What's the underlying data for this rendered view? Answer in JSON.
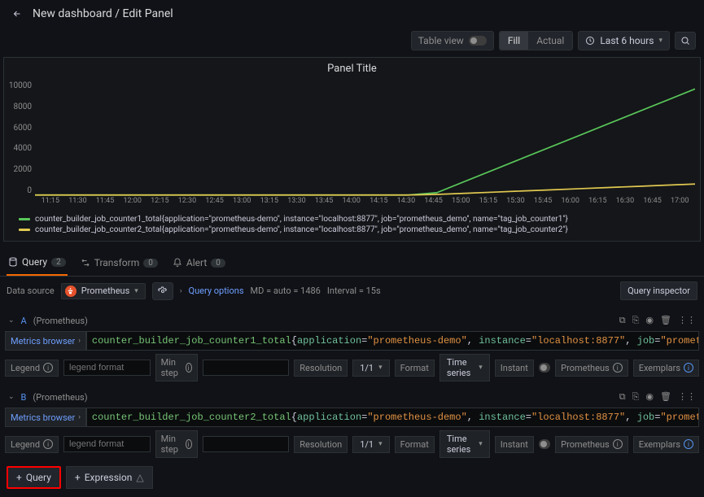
{
  "breadcrumb": "New dashboard / Edit Panel",
  "toolbar": {
    "table_view": "Table view",
    "fill": "Fill",
    "actual": "Actual",
    "time_range": "Last 6 hours"
  },
  "panel": {
    "title": "Panel Title"
  },
  "chart_data": {
    "type": "line",
    "x": [
      "11:15",
      "11:30",
      "11:45",
      "12:00",
      "12:15",
      "12:30",
      "12:45",
      "13:00",
      "13:15",
      "13:30",
      "13:45",
      "14:00",
      "14:15",
      "14:30",
      "14:45",
      "15:00",
      "15:15",
      "15:30",
      "15:45",
      "16:00",
      "16:45",
      "16:15",
      "16:30",
      "16:45",
      "17:00"
    ],
    "x_ticks": [
      "11:15",
      "11:30",
      "11:45",
      "12:00",
      "12:15",
      "12:30",
      "12:45",
      "13:00",
      "13:15",
      "13:30",
      "13:45",
      "14:00",
      "14:15",
      "14:30",
      "14:45",
      "15:00",
      "15:15",
      "15:30",
      "15:45",
      "16:00",
      "16:15",
      "16:30",
      "16:45",
      "17:00"
    ],
    "ylim": [
      0,
      10000
    ],
    "y_ticks": [
      10000,
      8000,
      6000,
      4000,
      2000,
      0
    ],
    "series": [
      {
        "name": "counter_builder_job_counter1_total{application=\"prometheus-demo\", instance=\"localhost:8877\", job=\"prometheus_demo\", name=\"tag_job_counter1\"}",
        "color": "#5ac75a",
        "values": [
          0,
          0,
          0,
          0,
          0,
          0,
          0,
          0,
          0,
          0,
          0,
          0,
          0,
          0,
          200,
          1200,
          2200,
          3200,
          4200,
          5200,
          6200,
          7200,
          8200,
          9200
        ]
      },
      {
        "name": "counter_builder_job_counter2_total{application=\"prometheus-demo\", instance=\"localhost:8877\", job=\"prometheus_demo\", name=\"tag_job_counter2\"}",
        "color": "#e0c850",
        "values": [
          0,
          0,
          0,
          0,
          0,
          0,
          0,
          0,
          0,
          0,
          0,
          0,
          0,
          0,
          50,
          150,
          250,
          350,
          450,
          550,
          650,
          750,
          850,
          950
        ]
      }
    ]
  },
  "tabs": {
    "query": "Query",
    "query_count": "2",
    "transform": "Transform",
    "transform_count": "0",
    "alert": "Alert",
    "alert_count": "0"
  },
  "datasource": {
    "label": "Data source",
    "name": "Prometheus",
    "query_options": "Query options",
    "md": "MD = auto = 1486",
    "interval": "Interval = 15s",
    "inspector": "Query inspector"
  },
  "queries": [
    {
      "letter": "A",
      "ds": "(Prometheus)",
      "metric": "counter_builder_job_counter1_total",
      "labels": [
        {
          "k": "application",
          "v": "\"prometheus-demo\""
        },
        {
          "k": "instance",
          "v": "\"localhost:8877\""
        },
        {
          "k": "job",
          "v": "\"prometheus_demo\""
        },
        {
          "k": "name",
          "v": "\"tag_job_counter1\""
        }
      ]
    },
    {
      "letter": "B",
      "ds": "(Prometheus)",
      "metric": "counter_builder_job_counter2_total",
      "labels": [
        {
          "k": "application",
          "v": "\"prometheus-demo\""
        },
        {
          "k": "instance",
          "v": "\"localhost:8877\""
        },
        {
          "k": "job",
          "v": "\"prometheus_demo\""
        },
        {
          "k": "name",
          "v": "\"tag_job_counter2\""
        }
      ]
    }
  ],
  "opt": {
    "metrics_browser": "Metrics browser",
    "legend": "Legend",
    "legend_ph": "legend format",
    "min_step": "Min step",
    "resolution": "Resolution",
    "resolution_val": "1/1",
    "format": "Format",
    "format_val": "Time series",
    "instant": "Instant",
    "prometheus": "Prometheus",
    "exemplars": "Exemplars"
  },
  "bottom": {
    "add_query": "Query",
    "add_expression": "Expression"
  }
}
